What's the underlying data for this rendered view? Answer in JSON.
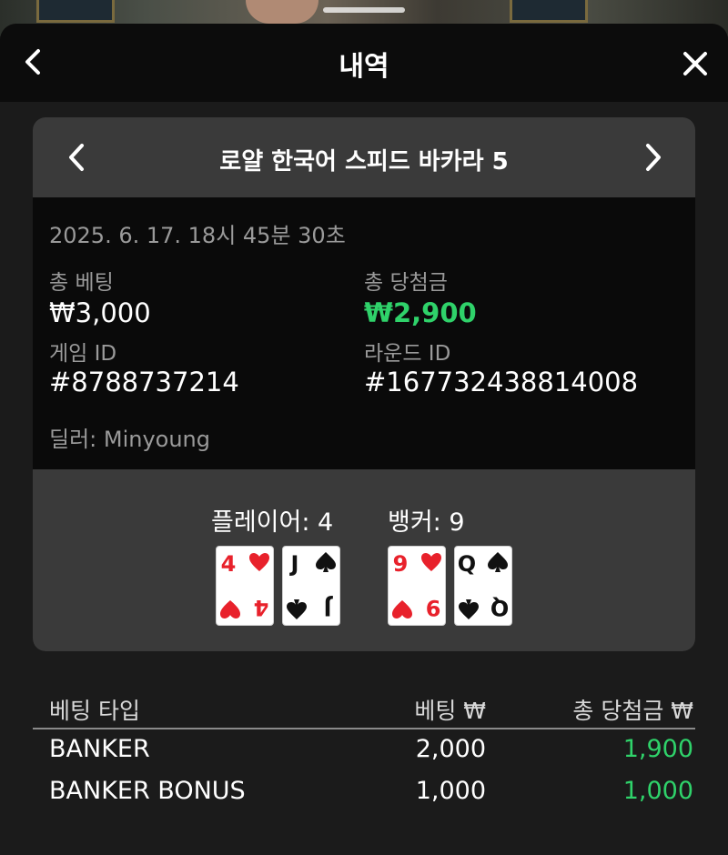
{
  "header": {
    "title": "내역"
  },
  "game": {
    "title": "로얄 한국어 스피드 바카라 5"
  },
  "round": {
    "datetime": "2025. 6. 17. 18시 45분 30초",
    "total_bet_label": "총 베팅",
    "total_bet_value": "₩3,000",
    "total_win_label": "총 당첨금",
    "total_win_value": "₩2,900",
    "game_id_label": "게임 ID",
    "game_id_value": "#8788737214",
    "round_id_label": "라운드 ID",
    "round_id_value": "#167732438814008",
    "dealer": "딜러: Minyoung"
  },
  "result": {
    "player_label": "플레이어: 4",
    "banker_label": "뱅커: 9",
    "player_cards": [
      {
        "rank": "4",
        "suit": "hearts"
      },
      {
        "rank": "J",
        "suit": "spades"
      }
    ],
    "banker_cards": [
      {
        "rank": "9",
        "suit": "hearts"
      },
      {
        "rank": "Q",
        "suit": "spades"
      }
    ]
  },
  "bets": {
    "headers": [
      "베팅 타입",
      "베팅 ₩",
      "총 당첨금 ₩"
    ],
    "rows": [
      [
        "BANKER",
        "2,000",
        "1,900"
      ],
      [
        "BANKER BONUS",
        "1,000",
        "1,000"
      ]
    ]
  },
  "colors": {
    "win_green": "#2fd26a",
    "card_red": "#e8212b",
    "card_black": "#111111"
  },
  "icons": {
    "back": "chevron-left-icon",
    "close": "close-icon",
    "prev": "chevron-left-icon",
    "next": "chevron-right-icon"
  }
}
